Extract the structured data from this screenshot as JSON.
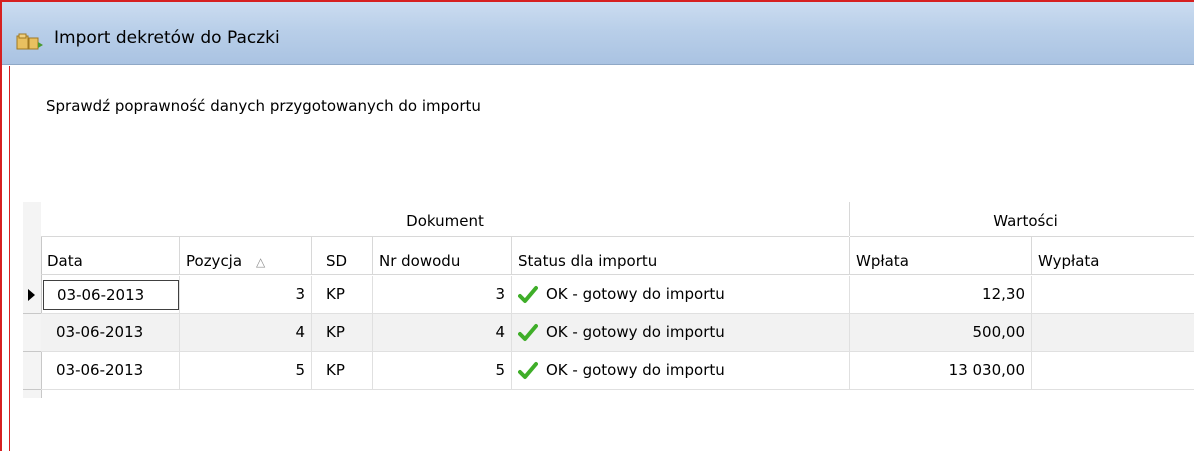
{
  "window": {
    "title": "Import dekretów do Paczki",
    "icon": "folder-import-icon",
    "border_color": "#d62020",
    "titlebar_color": "#b9cfe9"
  },
  "instruction": "Sprawdź poprawność danych przygotowanych do importu",
  "grid": {
    "bands": [
      {
        "label": "Dokument"
      },
      {
        "label": "Wartości"
      }
    ],
    "columns": [
      {
        "label": "Data"
      },
      {
        "label": "Pozycja",
        "sort_icon": "△"
      },
      {
        "label": "SD"
      },
      {
        "label": "Nr dowodu"
      },
      {
        "label": "Status dla importu"
      },
      {
        "label": "Wpłata"
      },
      {
        "label": "Wypłata"
      }
    ],
    "rows": [
      {
        "data": "03-06-2013",
        "pozycja": "3",
        "sd": "KP",
        "nr_dowodu": "3",
        "status": "OK - gotowy do importu",
        "status_icon": "checkmark-icon",
        "wplata": "12,30",
        "wyplata": "",
        "selected": true
      },
      {
        "data": "03-06-2013",
        "pozycja": "4",
        "sd": "KP",
        "nr_dowodu": "4",
        "status": "OK - gotowy do importu",
        "status_icon": "checkmark-icon",
        "wplata": "500,00",
        "wyplata": "",
        "selected": false
      },
      {
        "data": "03-06-2013",
        "pozycja": "5",
        "sd": "KP",
        "nr_dowodu": "5",
        "status": "OK - gotowy do importu",
        "status_icon": "checkmark-icon",
        "wplata": "13 030,00",
        "wyplata": "",
        "selected": false
      }
    ]
  }
}
